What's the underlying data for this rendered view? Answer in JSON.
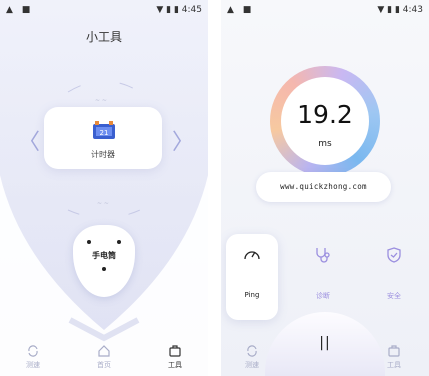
{
  "status": {
    "left_icons": "▲ ■",
    "right_text": "▼ ▮ ▮ 4:45",
    "right_text_2": "▼ ▮ ▮ 4:43"
  },
  "screen1": {
    "title": "小工具",
    "timer_label": "计时器",
    "flashlight_label": "手电筒",
    "faint_top": "~ ~",
    "faint_mid": "~ ~",
    "nav": [
      {
        "label": "测速",
        "icon": "refresh-icon"
      },
      {
        "label": "首页",
        "icon": "home-icon"
      },
      {
        "label": "工具",
        "icon": "toolbox-icon"
      }
    ]
  },
  "screen2": {
    "speed_value": "19.2",
    "speed_unit": "ms",
    "url": "www.quickzhong.com",
    "tools": [
      {
        "label": "Ping",
        "icon": "speedometer-icon"
      },
      {
        "label": "诊断",
        "icon": "stethoscope-icon"
      },
      {
        "label": "安全",
        "icon": "shield-check-icon"
      }
    ],
    "stop_label": "||",
    "nav": [
      {
        "label": "测速",
        "icon": "refresh-icon"
      },
      {
        "label": "工具",
        "icon": "toolbox-icon"
      }
    ]
  },
  "colors": {
    "accent": "#9b8fdf",
    "inactive": "#a9adc8"
  }
}
